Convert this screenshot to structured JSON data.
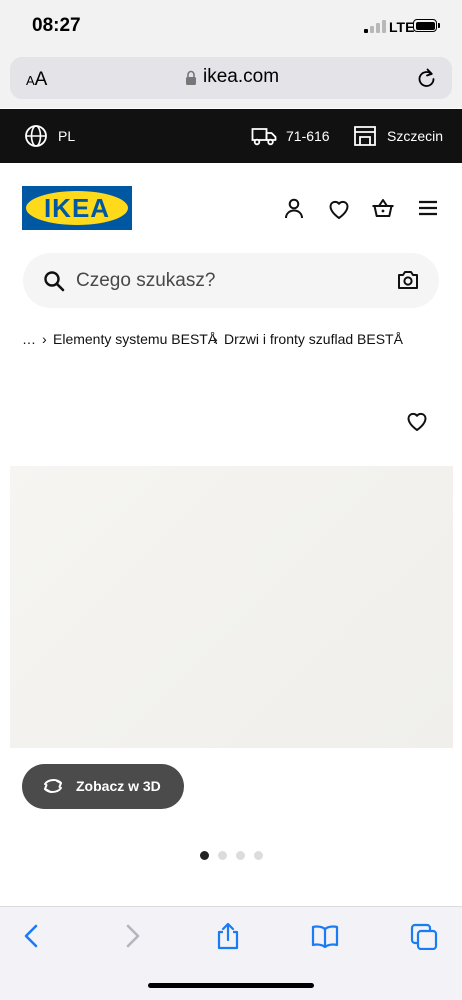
{
  "status_bar": {
    "time": "08:27",
    "network": "LTE",
    "battery_icon": "battery-icon"
  },
  "browser": {
    "text_size_label": "AA",
    "url": "ikea.com"
  },
  "top_band": {
    "language": "PL",
    "postal_code": "71-616",
    "store": "Szczecin"
  },
  "header": {
    "logo_text": "IKEA",
    "brand_blue": "#0058a3",
    "brand_yellow": "#ffda1a"
  },
  "search": {
    "placeholder": "Czego szukasz?"
  },
  "breadcrumb": {
    "ellipsis": "…",
    "items": [
      "Elementy systemu BESTÅ",
      "Drzwi i fronty szuflad BESTÅ"
    ]
  },
  "product": {
    "view3d_label": "Zobacz w 3D",
    "carousel": {
      "count": 4,
      "active": 1
    }
  }
}
